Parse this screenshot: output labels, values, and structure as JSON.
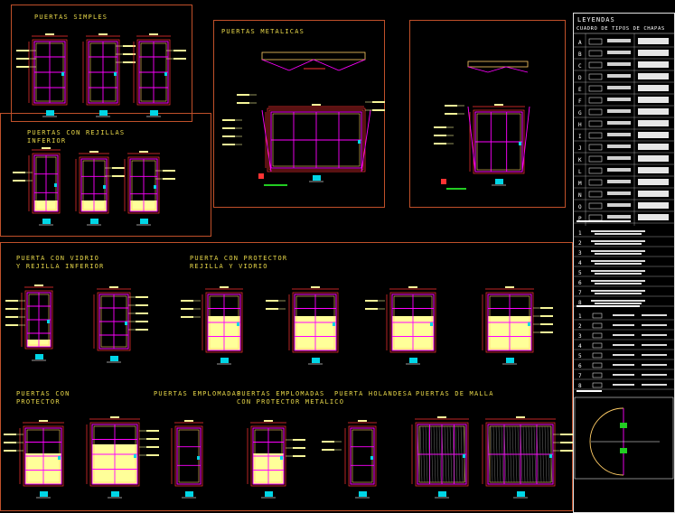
{
  "sheet": {
    "titles": {
      "simples": "PUERTAS SIMPLES",
      "metalicas": "PUERTAS METALICAS",
      "rejillas_1": "PUERTAS CON REJILLAS",
      "rejillas_2": "INFERIOR",
      "vidrio_1": "PUERTA CON VIDRIO",
      "vidrio_2": "Y REJILLA INFERIOR",
      "protector_1": "PUERTA CON PROTECTOR",
      "protector_2": "REJILLA Y VIDRIO",
      "con_protector_1": "PUERTAS CON",
      "con_protector_2": "PROTECTOR",
      "emplomadas": "PUERTAS EMPLOMADAS",
      "emplomadas_prot_1": "PUERTAS EMPLOMADAS",
      "emplomadas_prot_2": "CON PROTECTOR METALICO",
      "holandesa": "PUERTA HOLANDESA",
      "malla": "PUERTAS DE MALLA"
    },
    "legend": {
      "title": "LEYENDAS",
      "subtitle": "CUADRO DE TIPOS DE CHAPAS",
      "row_letters": [
        "A",
        "B",
        "C",
        "D",
        "E",
        "F",
        "G",
        "H",
        "I",
        "J",
        "K",
        "L",
        "M",
        "N",
        "O",
        "P"
      ],
      "row_numbers_2": [
        "1",
        "2",
        "3",
        "4",
        "5",
        "6",
        "7",
        "8"
      ],
      "row_numbers_3": [
        "1",
        "2",
        "3",
        "4",
        "5",
        "6",
        "7",
        "8"
      ]
    },
    "colors": {
      "frame": "#c0502a",
      "title_text": "#e8d84a",
      "door_line": "#ff00ff",
      "door_detail": "#ffcc66",
      "dimension": "#ff3333",
      "panel_fill": "#ffff99",
      "annotation": "#f5f598",
      "cyan_marker": "#00d6e6",
      "green_marker": "#22cc22"
    }
  }
}
